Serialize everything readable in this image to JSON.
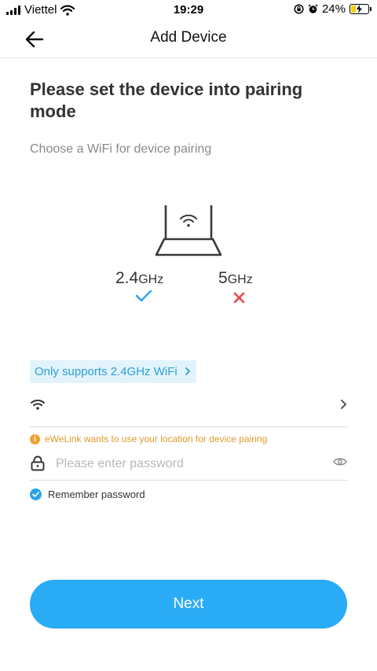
{
  "status_bar": {
    "carrier": "Viettel",
    "time": "19:29",
    "battery_percent": "24%",
    "battery_level": 0.24,
    "icons": [
      "signal-icon",
      "wifi-icon",
      "orientation-lock-icon",
      "alarm-icon",
      "battery-charging-icon"
    ]
  },
  "header": {
    "title": "Add Device",
    "back_icon": "arrow-left-icon"
  },
  "instructions": {
    "title": "Please set the device into pairing mode",
    "subtitle": "Choose a WiFi for device pairing"
  },
  "bands": {
    "supported": {
      "value": "2.4",
      "unit": "GHz",
      "status": "check"
    },
    "unsupported": {
      "value": "5",
      "unit": "GHz",
      "status": "cross"
    }
  },
  "support_link": "Only supports 2.4GHz WiFi",
  "wifi_selector": {
    "value": "",
    "icon": "wifi-icon"
  },
  "location_note": "eWeLink wants to use your location for device pairing",
  "password": {
    "placeholder": "Please enter password",
    "value": ""
  },
  "remember_password": {
    "label": "Remember password",
    "checked": true
  },
  "next_button": "Next",
  "colors": {
    "accent": "#2aabf6",
    "link": "#2a9fd8",
    "link_bg": "#e3f3fc",
    "warning": "#e09a2a",
    "error": "#e84a4a",
    "check": "#2aa4e8"
  }
}
